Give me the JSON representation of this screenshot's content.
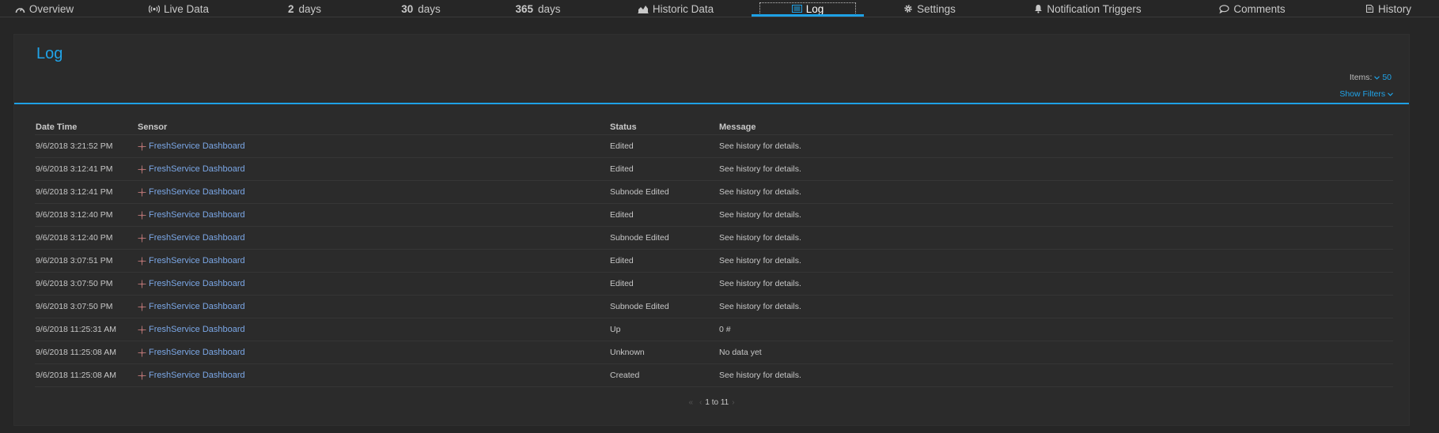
{
  "tabs": {
    "overview": {
      "label": "Overview",
      "icon": "gauge-icon"
    },
    "live": {
      "label": "Live Data",
      "icon": "broadcast-icon"
    },
    "d2": {
      "num": "2",
      "unit": "days"
    },
    "d30": {
      "num": "30",
      "unit": "days"
    },
    "d365": {
      "num": "365",
      "unit": "days"
    },
    "historic": {
      "label": "Historic Data",
      "icon": "area-chart-icon"
    },
    "log": {
      "label": "Log",
      "icon": "list-icon",
      "active": true
    },
    "settings": {
      "label": "Settings",
      "icon": "gear-icon"
    },
    "triggers": {
      "label": "Notification Triggers",
      "icon": "bell-icon"
    },
    "comments": {
      "label": "Comments",
      "icon": "comment-icon"
    },
    "history": {
      "label": "History",
      "icon": "history-icon"
    }
  },
  "panel": {
    "title": "Log",
    "items_label": "Items:",
    "items_value": "50",
    "show_filters": "Show Filters"
  },
  "table": {
    "headers": [
      "Date Time",
      "Sensor",
      "Status",
      "Message"
    ],
    "rows": [
      {
        "datetime": "9/6/2018 3:21:52 PM",
        "sensor": "FreshService Dashboard",
        "status": "Edited",
        "message": "See history for details."
      },
      {
        "datetime": "9/6/2018 3:12:41 PM",
        "sensor": "FreshService Dashboard",
        "status": "Edited",
        "message": "See history for details."
      },
      {
        "datetime": "9/6/2018 3:12:41 PM",
        "sensor": "FreshService Dashboard",
        "status": "Subnode Edited",
        "message": "See history for details."
      },
      {
        "datetime": "9/6/2018 3:12:40 PM",
        "sensor": "FreshService Dashboard",
        "status": "Edited",
        "message": "See history for details."
      },
      {
        "datetime": "9/6/2018 3:12:40 PM",
        "sensor": "FreshService Dashboard",
        "status": "Subnode Edited",
        "message": "See history for details."
      },
      {
        "datetime": "9/6/2018 3:07:51 PM",
        "sensor": "FreshService Dashboard",
        "status": "Edited",
        "message": "See history for details."
      },
      {
        "datetime": "9/6/2018 3:07:50 PM",
        "sensor": "FreshService Dashboard",
        "status": "Edited",
        "message": "See history for details."
      },
      {
        "datetime": "9/6/2018 3:07:50 PM",
        "sensor": "FreshService Dashboard",
        "status": "Subnode Edited",
        "message": "See history for details."
      },
      {
        "datetime": "9/6/2018 11:25:31 AM",
        "sensor": "FreshService Dashboard",
        "status": "Up",
        "message": "0 #"
      },
      {
        "datetime": "9/6/2018 11:25:08 AM",
        "sensor": "FreshService Dashboard",
        "status": "Unknown",
        "message": "No data yet"
      },
      {
        "datetime": "9/6/2018 11:25:08 AM",
        "sensor": "FreshService Dashboard",
        "status": "Created",
        "message": "See history for details."
      }
    ]
  },
  "pager": {
    "first": "«",
    "prev": "‹",
    "range": "1 to 11",
    "next": "›"
  },
  "colors": {
    "accent": "#1ea1e6",
    "link": "#7ba7e6",
    "background": "#262626",
    "panel": "#2b2b2b"
  }
}
